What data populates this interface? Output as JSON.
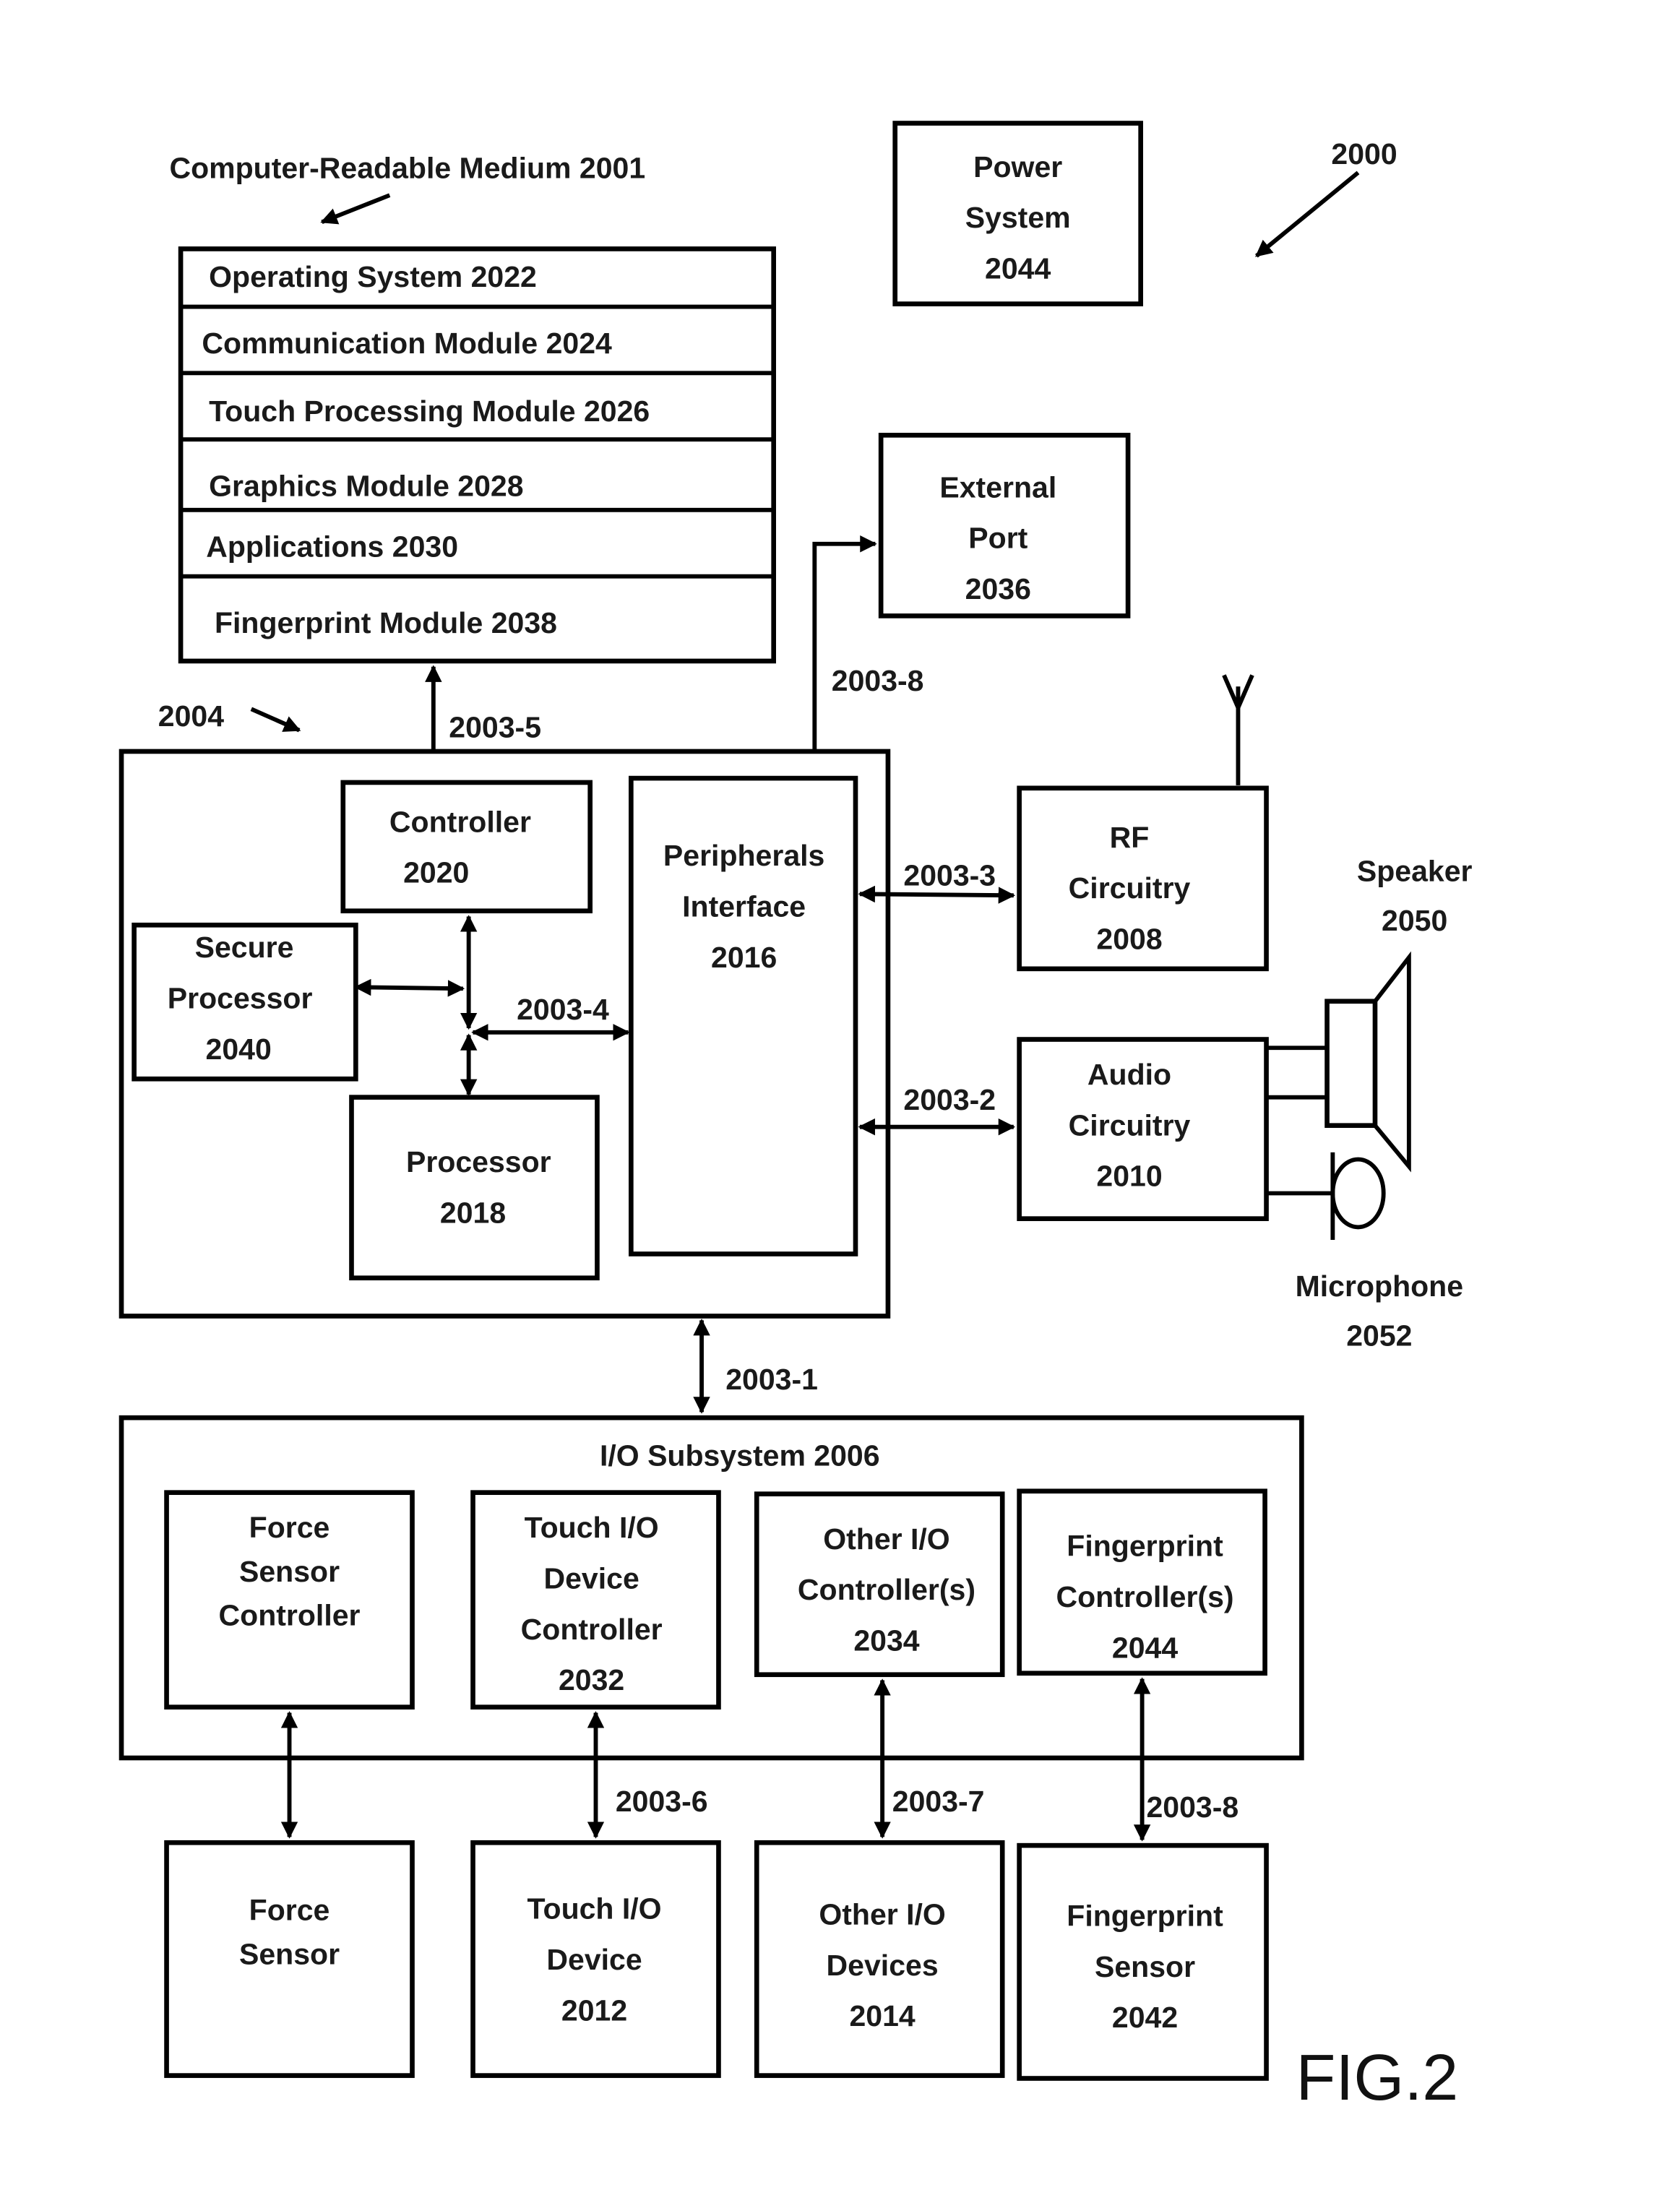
{
  "figure": {
    "label": "FIG.2",
    "reference": "2000"
  },
  "medium": {
    "title": "Computer-Readable Medium 2001",
    "modules": [
      "Operating System 2022",
      "Communication Module 2024",
      "Touch Processing Module 2026",
      "Graphics Module 2028",
      "Applications 2030",
      "Fingerprint Module 2038"
    ]
  },
  "power": {
    "lines": [
      "Power",
      "System",
      "2044"
    ]
  },
  "external_port": {
    "lines": [
      "External",
      "Port",
      "2036"
    ]
  },
  "processing": {
    "ref": "2004",
    "controller": {
      "lines": [
        "Controller",
        "2020"
      ]
    },
    "secure_processor": {
      "lines": [
        "Secure",
        "Processor",
        "2040"
      ]
    },
    "processor": {
      "lines": [
        "Processor",
        "2018"
      ]
    },
    "peripherals": {
      "lines": [
        "Peripherals",
        "Interface",
        "2016"
      ]
    }
  },
  "rf": {
    "lines": [
      "RF",
      "Circuitry",
      "2008"
    ]
  },
  "audio": {
    "lines": [
      "Audio",
      "Circuitry",
      "2010"
    ]
  },
  "speaker": {
    "lines": [
      "Speaker",
      "2050"
    ]
  },
  "microphone": {
    "lines": [
      "Microphone",
      "2052"
    ]
  },
  "buses": {
    "b1": "2003-1",
    "b2": "2003-2",
    "b3": "2003-3",
    "b4": "2003-4",
    "b5": "2003-5",
    "b6": "2003-6",
    "b7": "2003-7",
    "b8_top": "2003-8",
    "b8_bottom": "2003-8"
  },
  "io": {
    "title": "I/O Subsystem 2006",
    "force_controller": {
      "lines": [
        "Force",
        "Sensor",
        "Controller"
      ]
    },
    "touch_controller": {
      "lines": [
        "Touch I/O",
        "Device",
        "Controller",
        "2032"
      ]
    },
    "other_controller": {
      "lines": [
        "Other I/O",
        "Controller(s)",
        "2034"
      ]
    },
    "fingerprint_controller": {
      "lines": [
        "Fingerprint",
        "Controller(s)",
        "2044"
      ]
    }
  },
  "devices": {
    "force_sensor": {
      "lines": [
        "Force",
        "Sensor"
      ]
    },
    "touch_device": {
      "lines": [
        "Touch I/O",
        "Device",
        "2012"
      ]
    },
    "other_devices": {
      "lines": [
        "Other I/O",
        "Devices",
        "2014"
      ]
    },
    "fingerprint_sensor": {
      "lines": [
        "Fingerprint",
        "Sensor",
        "2042"
      ]
    }
  }
}
